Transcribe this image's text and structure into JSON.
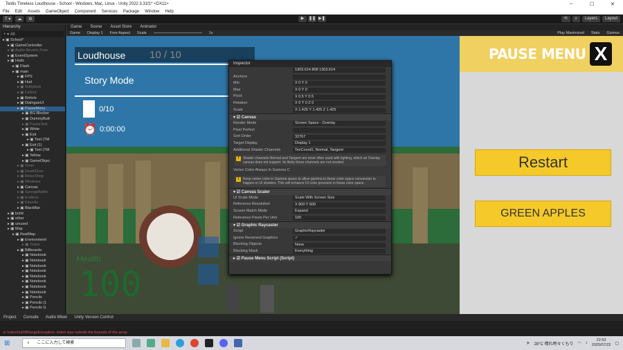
{
  "window": {
    "title": "Teldis Timeless Loudhouse - School - Windows, Mac, Linux - Unity 2022.3.31f1* <DX11>"
  },
  "menu": [
    "File",
    "Edit",
    "Assets",
    "GameObject",
    "Component",
    "Services",
    "Package",
    "Window",
    "Help"
  ],
  "toolbar": {
    "layers": "Layers",
    "layout": "Layout"
  },
  "hierarchy": {
    "tab": "Hierarchy",
    "search_placeholder": "All",
    "rows": [
      {
        "label": "School*",
        "indent": 0,
        "state": "normal"
      },
      {
        "label": "GameController",
        "indent": 1,
        "state": "normal"
      },
      {
        "label": "Audio Reverb Zone",
        "indent": 1,
        "state": "dim"
      },
      {
        "label": "EventSystem",
        "indent": 1,
        "state": "normal"
      },
      {
        "label": "Huds",
        "indent": 1,
        "state": "normal"
      },
      {
        "label": "Flash",
        "indent": 2,
        "state": "normal"
      },
      {
        "label": "main",
        "indent": 2,
        "state": "normal"
      },
      {
        "label": "FPS",
        "indent": 3,
        "state": "normal"
      },
      {
        "label": "Hud",
        "indent": 3,
        "state": "normal"
      },
      {
        "label": "SoftyHud",
        "indent": 3,
        "state": "dim"
      },
      {
        "label": "Fallout",
        "indent": 3,
        "state": "dim"
      },
      {
        "label": "Reticle",
        "indent": 3,
        "state": "normal"
      },
      {
        "label": "DialogueUI",
        "indent": 3,
        "state": "normal"
      },
      {
        "label": "PauseMenu",
        "indent": 3,
        "state": "sel"
      },
      {
        "label": "BG Blocker",
        "indent": 4,
        "state": "normal"
      },
      {
        "label": "DummyButt",
        "indent": 4,
        "state": "normal"
      },
      {
        "label": "PauseText",
        "indent": 4,
        "state": "dim"
      },
      {
        "label": "White",
        "indent": 4,
        "state": "normal"
      },
      {
        "label": "Exit",
        "indent": 4,
        "state": "normal"
      },
      {
        "label": "Text (TM",
        "indent": 5,
        "state": "normal"
      },
      {
        "label": "Exit (1)",
        "indent": 4,
        "state": "normal"
      },
      {
        "label": "Text (TM",
        "indent": 5,
        "state": "normal"
      },
      {
        "label": "Yellow",
        "indent": 4,
        "state": "normal"
      },
      {
        "label": "GameObjec",
        "indent": 4,
        "state": "normal"
      },
      {
        "label": "Timer",
        "indent": 3,
        "state": "dim"
      },
      {
        "label": "DeathOver",
        "indent": 3,
        "state": "dim"
      },
      {
        "label": "RelaxShop",
        "indent": 3,
        "state": "dim"
      },
      {
        "label": "Windows",
        "indent": 3,
        "state": "dim"
      },
      {
        "label": "Canvas",
        "indent": 3,
        "state": "normal"
      },
      {
        "label": "SpongeBathe",
        "indent": 3,
        "state": "dim"
      },
      {
        "label": "Endless",
        "indent": 3,
        "state": "dim"
      },
      {
        "label": "Kinvelle",
        "indent": 3,
        "state": "dim"
      },
      {
        "label": "BlackBar",
        "indent": 3,
        "state": "normal"
      },
      {
        "label": "build",
        "indent": 1,
        "state": "normal"
      },
      {
        "label": "other",
        "indent": 1,
        "state": "normal"
      },
      {
        "label": "unused",
        "indent": 1,
        "state": "normal"
      },
      {
        "label": "Map",
        "indent": 1,
        "state": "normal"
      },
      {
        "label": "RealMap",
        "indent": 2,
        "state": "normal"
      },
      {
        "label": "Environment",
        "indent": 3,
        "state": "normal"
      },
      {
        "label": "Tinker",
        "indent": 4,
        "state": "dim"
      },
      {
        "label": "Billboards",
        "indent": 3,
        "state": "normal"
      },
      {
        "label": "Notebook",
        "indent": 4,
        "state": "normal"
      },
      {
        "label": "Notebook",
        "indent": 4,
        "state": "normal"
      },
      {
        "label": "Notebook",
        "indent": 4,
        "state": "normal"
      },
      {
        "label": "Notebook",
        "indent": 4,
        "state": "normal"
      },
      {
        "label": "Notebook",
        "indent": 4,
        "state": "normal"
      },
      {
        "label": "Notebook",
        "indent": 4,
        "state": "normal"
      },
      {
        "label": "Notebook",
        "indent": 4,
        "state": "normal"
      },
      {
        "label": "Notebook",
        "indent": 4,
        "state": "normal"
      },
      {
        "label": "Pencils",
        "indent": 4,
        "state": "normal"
      },
      {
        "label": "Pencils (1",
        "indent": 4,
        "state": "normal"
      },
      {
        "label": "Pencils G",
        "indent": 4,
        "state": "normal"
      }
    ]
  },
  "game": {
    "tabs": [
      "Game",
      "Scene",
      "Asset Store",
      "Animator"
    ],
    "bar": [
      "Game",
      "Display 1",
      "Free Aspect",
      "Scale",
      "1x",
      "Play Maximized",
      "Stats",
      "Gizmos"
    ]
  },
  "hud": {
    "player": "Loudhouse",
    "notebooks_top": "10 / 10",
    "mode": "Story Mode",
    "notebooks": "0/10",
    "time": "0:00:00",
    "health_label": "Health",
    "health": "100"
  },
  "pause": {
    "title": "PAUSE MENU",
    "close": "X",
    "restart": "Restart",
    "green": "GREEN APPLES"
  },
  "inspector": {
    "title": "Inspector",
    "rect": [
      {
        "k": "",
        "v": "1303.614     808     1303.614"
      },
      {
        "k": "Anchors",
        "v": ""
      },
      {
        "k": "Min",
        "v": "X  0          Y  0"
      },
      {
        "k": "Max",
        "v": "X  0          Y  0"
      },
      {
        "k": "Pivot",
        "v": "X  0.5       Y  0.5"
      },
      {
        "k": "Rotation",
        "v": "X  0     Y  0     Z  0"
      },
      {
        "k": "Scale",
        "v": "X  1.425   Y  1.425   Z  1.425"
      }
    ],
    "canvas_title": "Canvas",
    "canvas": [
      {
        "k": "Render Mode",
        "v": "Screen Space - Overlay"
      },
      {
        "k": "Pixel Perfect",
        "v": ""
      },
      {
        "k": "Sort Order",
        "v": "32767"
      },
      {
        "k": "Target Display",
        "v": "Display 1"
      },
      {
        "k": "Additional Shader Channels",
        "v": "TexCoord1, Normal, Tangent"
      }
    ],
    "info1": "Shader channels Normal and Tangent are most often used with lighting, which an Overlay canvas does not support. Its likely these channels are not needed.",
    "gamma": "Vertex Color Always In Gamma C",
    "info2": "Keep vertex color in Gamma space to allow gamma to linear color space conversion to happen in UI shaders. This will enhance UI color precision in linear color space.",
    "scaler_title": "Canvas Scaler",
    "scaler": [
      {
        "k": "UI Scale Mode",
        "v": "Scale With Screen Size"
      },
      {
        "k": "Reference Resolution",
        "v": "X  800       Y  600"
      },
      {
        "k": "Screen Match Mode",
        "v": "Expand"
      },
      {
        "k": "Reference Pixels Per Unit",
        "v": "100"
      }
    ],
    "ray_title": "Graphic Raycaster",
    "ray": [
      {
        "k": "Script",
        "v": "GraphicRaycaster"
      },
      {
        "k": "Ignore Reversed Graphics",
        "v": "✓"
      },
      {
        "k": "Blocking Objects",
        "v": "None"
      },
      {
        "k": "Blocking Mask",
        "v": "Everything"
      }
    ],
    "script_title": "Pause Menu Script (Script)"
  },
  "bottom": {
    "tabs": [
      "Project",
      "Console",
      "Audio Mixer",
      "Unity Version Control"
    ]
  },
  "error": "IndexOutOfRangeException: Index was outside the bounds of the array.",
  "taskbar": {
    "search": "ここに入力して検索",
    "weather": "28°C  晴れ時々くもり",
    "time": "22:53",
    "date": "2025/07/22"
  },
  "colors": {
    "accent": "#f6c92a",
    "header": "#f0d060",
    "selection": "#2c5d87"
  }
}
